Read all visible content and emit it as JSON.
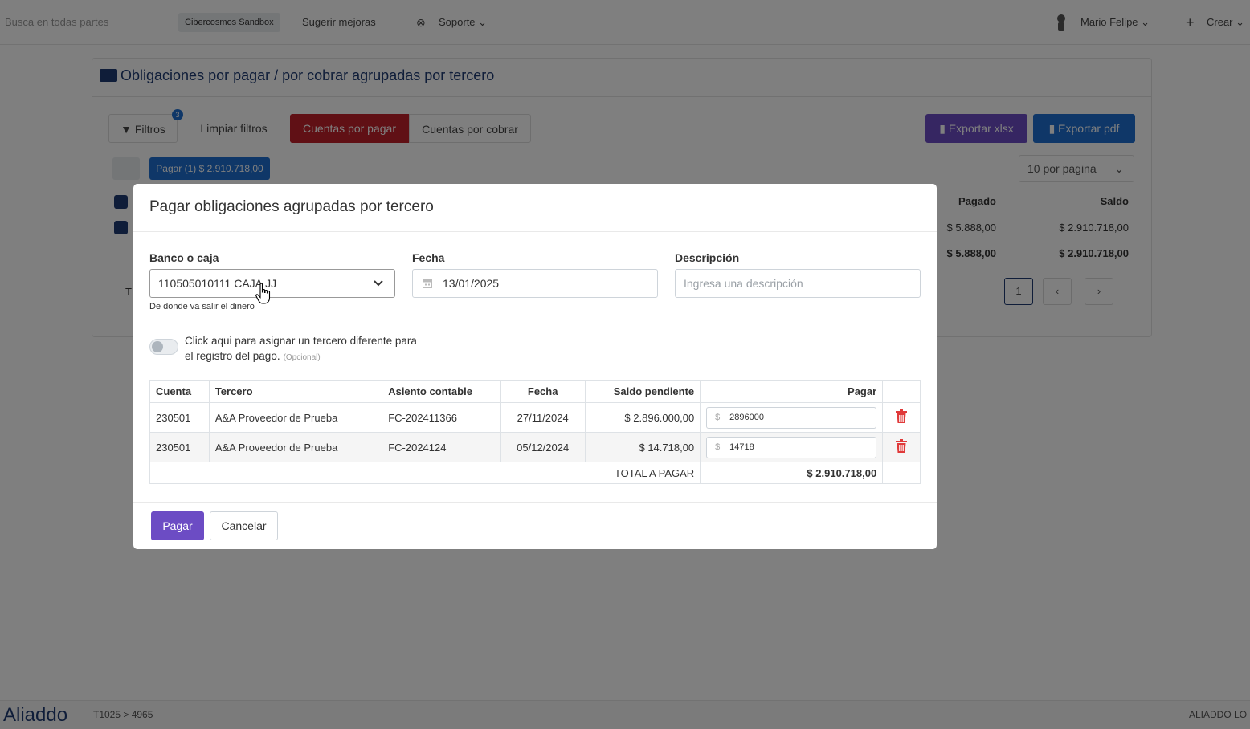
{
  "topbar": {
    "search_placeholder": "Busca en todas partes",
    "company_badge": "Cibercosmos Sandbox",
    "suggest_label": "Sugerir mejoras",
    "support_label": "Soporte",
    "user_name": "Mario Felipe",
    "create_label": "Crear"
  },
  "page": {
    "title": "Obligaciones por pagar / por cobrar agrupadas por tercero",
    "filters_label": "Filtros",
    "filters_badge": "3",
    "clear_filters_label": "Limpiar filtros",
    "tabs": [
      {
        "label": "Cuentas por pagar",
        "active": true
      },
      {
        "label": "Cuentas por cobrar",
        "active": false
      }
    ],
    "export_xlsx_label": "Exportar xlsx",
    "export_pdf_label": "Exportar pdf",
    "pay_selected_label": "Pagar (1) $ 2.910.718,00",
    "per_page_label": "10 por pagina",
    "columns": {
      "paid": "Pagado",
      "balance": "Saldo"
    },
    "rows": [
      {
        "paid": "$ 5.888,00",
        "balance": "$ 2.910.718,00"
      },
      {
        "paid": "$ 5.888,00",
        "balance": "$ 2.910.718,00"
      }
    ],
    "totals_prefix": "T",
    "current_page": "1"
  },
  "modal": {
    "title": "Pagar obligaciones agrupadas por tercero",
    "bank_label": "Banco o caja",
    "bank_value": "110505010111 CAJA JJ",
    "bank_helper": "De donde va salir el dinero",
    "date_label": "Fecha",
    "date_value": "13/01/2025",
    "description_label": "Descripción",
    "description_placeholder": "Ingresa una descripción",
    "toggle_text": "Click aqui para asignar un tercero diferente para el registro del pago.",
    "toggle_optional": "(Opcional)",
    "table": {
      "headers": {
        "account": "Cuenta",
        "third_party": "Tercero",
        "entry": "Asiento contable",
        "date": "Fecha",
        "pending": "Saldo pendiente",
        "pay": "Pagar"
      },
      "rows": [
        {
          "account": "230501",
          "third_party": "A&A Proveedor de Prueba",
          "entry": "FC-202411366",
          "date": "27/11/2024",
          "pending": "$ 2.896.000,00",
          "pay_currency": "$",
          "pay_value": "2896000"
        },
        {
          "account": "230501",
          "third_party": "A&A Proveedor de Prueba",
          "entry": "FC-2024124",
          "date": "05/12/2024",
          "pending": "$ 14.718,00",
          "pay_currency": "$",
          "pay_value": "14718"
        }
      ],
      "total_label": "TOTAL A PAGAR",
      "total_value": "$ 2.910.718,00"
    },
    "pay_button": "Pagar",
    "cancel_button": "Cancelar"
  },
  "footer": {
    "logo_text": "Aliaddo",
    "version": "T1025 > 4965",
    "right_text": "ALIADDO LO"
  },
  "colors": {
    "primary_purple": "#6c4cc4",
    "navy": "#1f3b73",
    "danger": "#e03a3a",
    "overlay": "rgba(0,0,0,0.5)"
  }
}
